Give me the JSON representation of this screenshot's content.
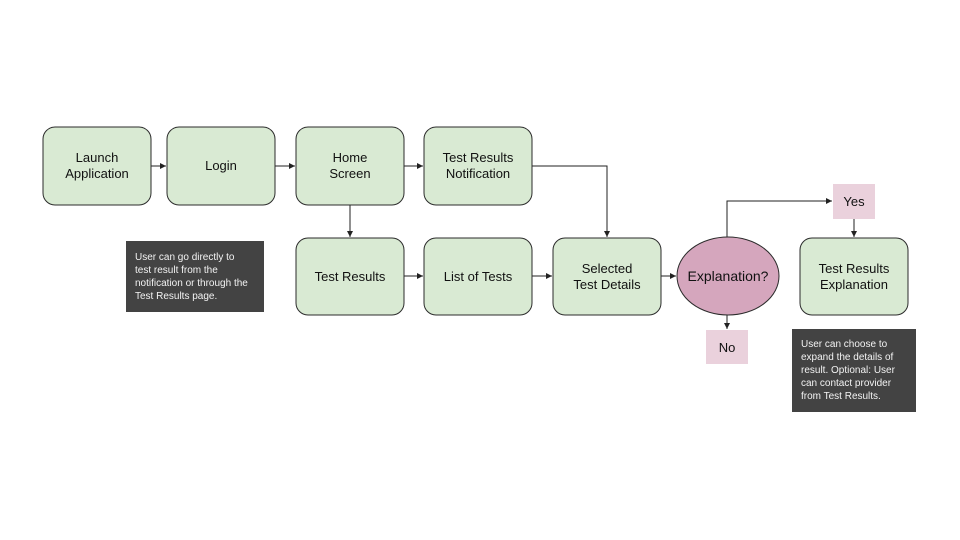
{
  "colors": {
    "process_fill": "#d9ead3",
    "decision_fill": "#d5a6bd",
    "label_fill": "#ead1dc",
    "note_fill": "#434343"
  },
  "nodes": {
    "launch": [
      "Launch",
      "Application"
    ],
    "login": [
      "Login"
    ],
    "home": [
      "Home",
      "Screen"
    ],
    "notification": [
      "Test Results",
      "Notification"
    ],
    "test_results": [
      "Test Results"
    ],
    "list_of_tests": [
      "List of Tests"
    ],
    "selected": [
      "Selected",
      "Test Details"
    ],
    "decision": [
      "Explanation?"
    ],
    "yes": [
      "Yes"
    ],
    "no": [
      "No"
    ],
    "explanation": [
      "Test Results",
      "Explanation"
    ]
  },
  "notes": {
    "note1": [
      "User can go directly to",
      "test result from the",
      "notification or through the",
      "Test Results page."
    ],
    "note2": [
      "User can choose to",
      "expand the details of",
      "result. Optional: User",
      "can contact provider",
      "from Test Results."
    ]
  }
}
